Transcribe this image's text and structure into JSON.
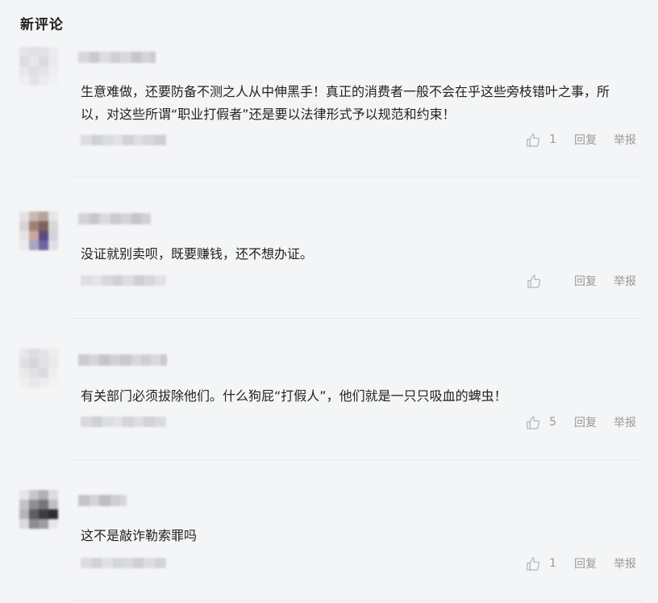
{
  "section": {
    "title": "新评论"
  },
  "comments": [
    {
      "text": "生意难做，还要防备不测之人从中伸黑手！真正的消费者一般不会在乎这些旁枝错叶之事，所以，对这些所谓“职业打假者”还是要以法律形式予以规范和约束！",
      "likes": "1",
      "reply_label": "回复",
      "report_label": "举报"
    },
    {
      "text": "没证就别卖呗，既要赚钱，还不想办证。",
      "likes": "",
      "reply_label": "回复",
      "report_label": "举报"
    },
    {
      "text": "有关部门必须拔除他们。什么狗屁“打假人”，他们就是一只只吸血的蜱虫！",
      "likes": "5",
      "reply_label": "回复",
      "report_label": "举报"
    },
    {
      "text": "这不是敲诈勒索罪吗",
      "likes": "1",
      "reply_label": "回复",
      "report_label": "举报"
    }
  ],
  "icons": {
    "like": "thumbs-up-icon"
  },
  "colors": {
    "background": "#f4f5f6",
    "text": "#222222",
    "muted": "#999999",
    "divider": "#e6e7e9"
  }
}
